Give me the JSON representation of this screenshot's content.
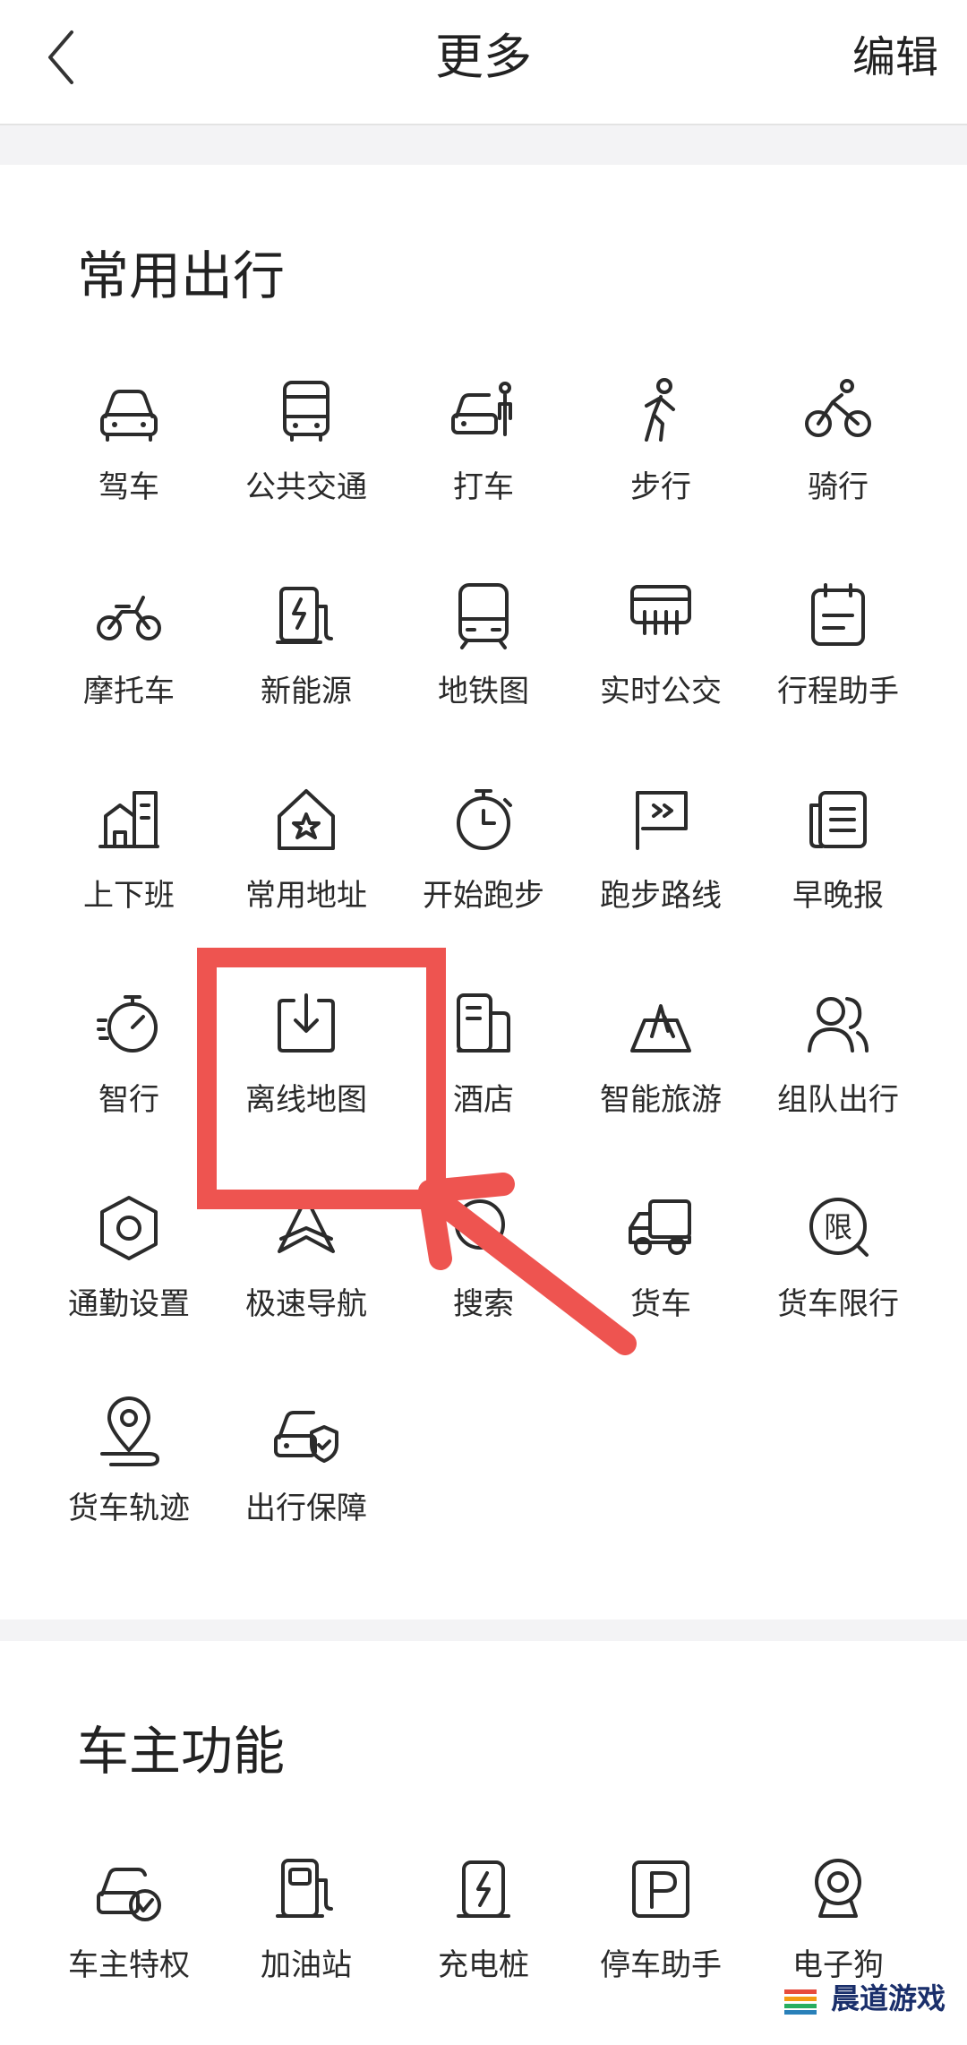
{
  "header": {
    "title": "更多",
    "edit_label": "编辑"
  },
  "sections": [
    {
      "title": "常用出行",
      "items": [
        {
          "label": "驾车",
          "icon": "car-icon"
        },
        {
          "label": "公共交通",
          "icon": "bus-icon"
        },
        {
          "label": "打车",
          "icon": "taxi-icon"
        },
        {
          "label": "步行",
          "icon": "walk-icon"
        },
        {
          "label": "骑行",
          "icon": "bike-icon"
        },
        {
          "label": "摩托车",
          "icon": "motorcycle-icon"
        },
        {
          "label": "新能源",
          "icon": "charging-station-icon"
        },
        {
          "label": "地铁图",
          "icon": "subway-icon"
        },
        {
          "label": "实时公交",
          "icon": "bus-stop-icon"
        },
        {
          "label": "行程助手",
          "icon": "calendar-icon"
        },
        {
          "label": "上下班",
          "icon": "office-icon"
        },
        {
          "label": "常用地址",
          "icon": "home-star-icon"
        },
        {
          "label": "开始跑步",
          "icon": "stopwatch-icon"
        },
        {
          "label": "跑步路线",
          "icon": "flag-icon"
        },
        {
          "label": "早晚报",
          "icon": "newspaper-icon"
        },
        {
          "label": "智行",
          "icon": "speed-timer-icon"
        },
        {
          "label": "离线地图",
          "icon": "download-icon"
        },
        {
          "label": "酒店",
          "icon": "hotel-icon"
        },
        {
          "label": "智能旅游",
          "icon": "scenic-icon"
        },
        {
          "label": "组队出行",
          "icon": "group-icon"
        },
        {
          "label": "通勤设置",
          "icon": "hexagon-settings-icon"
        },
        {
          "label": "极速导航",
          "icon": "navigation-arrow-icon"
        },
        {
          "label": "搜索",
          "icon": "search-icon"
        },
        {
          "label": "货车",
          "icon": "truck-icon"
        },
        {
          "label": "货车限行",
          "icon": "truck-restriction-icon"
        },
        {
          "label": "货车轨迹",
          "icon": "location-track-icon"
        },
        {
          "label": "出行保障",
          "icon": "car-shield-icon"
        }
      ]
    },
    {
      "title": "车主功能",
      "items": [
        {
          "label": "车主特权",
          "icon": "car-check-icon"
        },
        {
          "label": "加油站",
          "icon": "gas-station-icon"
        },
        {
          "label": "充电桩",
          "icon": "charging-pile-icon"
        },
        {
          "label": "停车助手",
          "icon": "parking-icon"
        },
        {
          "label": "电子狗",
          "icon": "camera-icon"
        }
      ]
    }
  ],
  "annotation": {
    "highlight_color": "#ee5450",
    "highlighted_item": "离线地图"
  },
  "watermark": {
    "text": "晨道游戏"
  }
}
